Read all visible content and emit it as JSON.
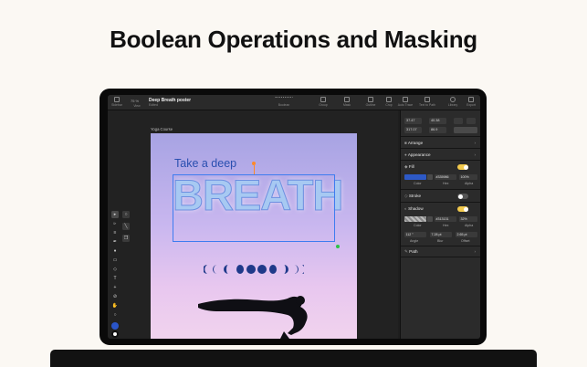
{
  "heading": "Boolean Operations and Masking",
  "toolbar": {
    "zoom": "75 %",
    "doc_title": "Deep Breath poster",
    "doc_subtitle": "Edited",
    "items": [
      {
        "label": "Sidebar"
      },
      {
        "label": "View"
      },
      {
        "label": "Boolean"
      },
      {
        "label": "Group"
      },
      {
        "label": "Mask"
      },
      {
        "label": "Outline"
      },
      {
        "label": "Crop"
      },
      {
        "label": "Auto Trace"
      },
      {
        "label": "Text to Path"
      },
      {
        "label": "Library"
      },
      {
        "label": "Export"
      }
    ]
  },
  "artboard": {
    "label": "Yoga Course",
    "take_text": "Take a deep",
    "breath_text": "BREATH"
  },
  "panel": {
    "coords": [
      "37.47",
      "40.38",
      "317.07",
      "86.9"
    ],
    "sections": {
      "arrange": "Arrange",
      "appearance": "Appearance",
      "fill": "Fill",
      "stroke": "Stroke",
      "shadow": "Shadow",
      "path": "Path"
    },
    "fill": {
      "hex": "#335986",
      "alpha": "100%",
      "color_label": "Color",
      "hex_label": "Hex",
      "alpha_label": "Alpha"
    },
    "shadow": {
      "hex": "#313131",
      "alpha": "32%",
      "color_label": "Color",
      "hex_label": "Hex",
      "alpha_label": "Alpha",
      "angle": "112 °",
      "blur": "7.28 pt",
      "offset": "2.65 pt",
      "angle_label": "Angle",
      "blur_label": "Blur",
      "offset_label": "Offset"
    }
  },
  "colors": {
    "accent": "#3e7cf0",
    "toggle_on": "#f2c94c",
    "fill_color": "#2d59c6"
  }
}
